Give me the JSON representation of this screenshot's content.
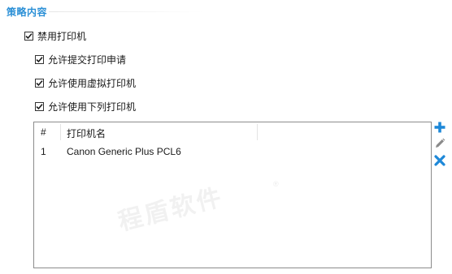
{
  "section": {
    "title": "策略内容"
  },
  "options": {
    "disable_printer": {
      "label": "禁用打印机",
      "checked": true
    },
    "allow_submit_request": {
      "label": "允许提交打印申请",
      "checked": true
    },
    "allow_virtual_printer": {
      "label": "允许使用虚拟打印机",
      "checked": true
    },
    "allow_listed_printers": {
      "label": "允许使用下列打印机",
      "checked": true
    }
  },
  "printer_table": {
    "columns": [
      "#",
      "打印机名"
    ],
    "rows": [
      {
        "index": "1",
        "name": "Canon Generic Plus PCL6"
      }
    ]
  },
  "actions": {
    "add_icon": "plus-icon",
    "edit_icon": "pencil-icon",
    "delete_icon": "x-icon"
  },
  "colors": {
    "accent": "#2a8fd6",
    "add": "#1e88d8",
    "delete": "#1e88d8",
    "edit": "#8a8a8a"
  },
  "watermark": {
    "text": "程盾软件",
    "mark": "®"
  }
}
